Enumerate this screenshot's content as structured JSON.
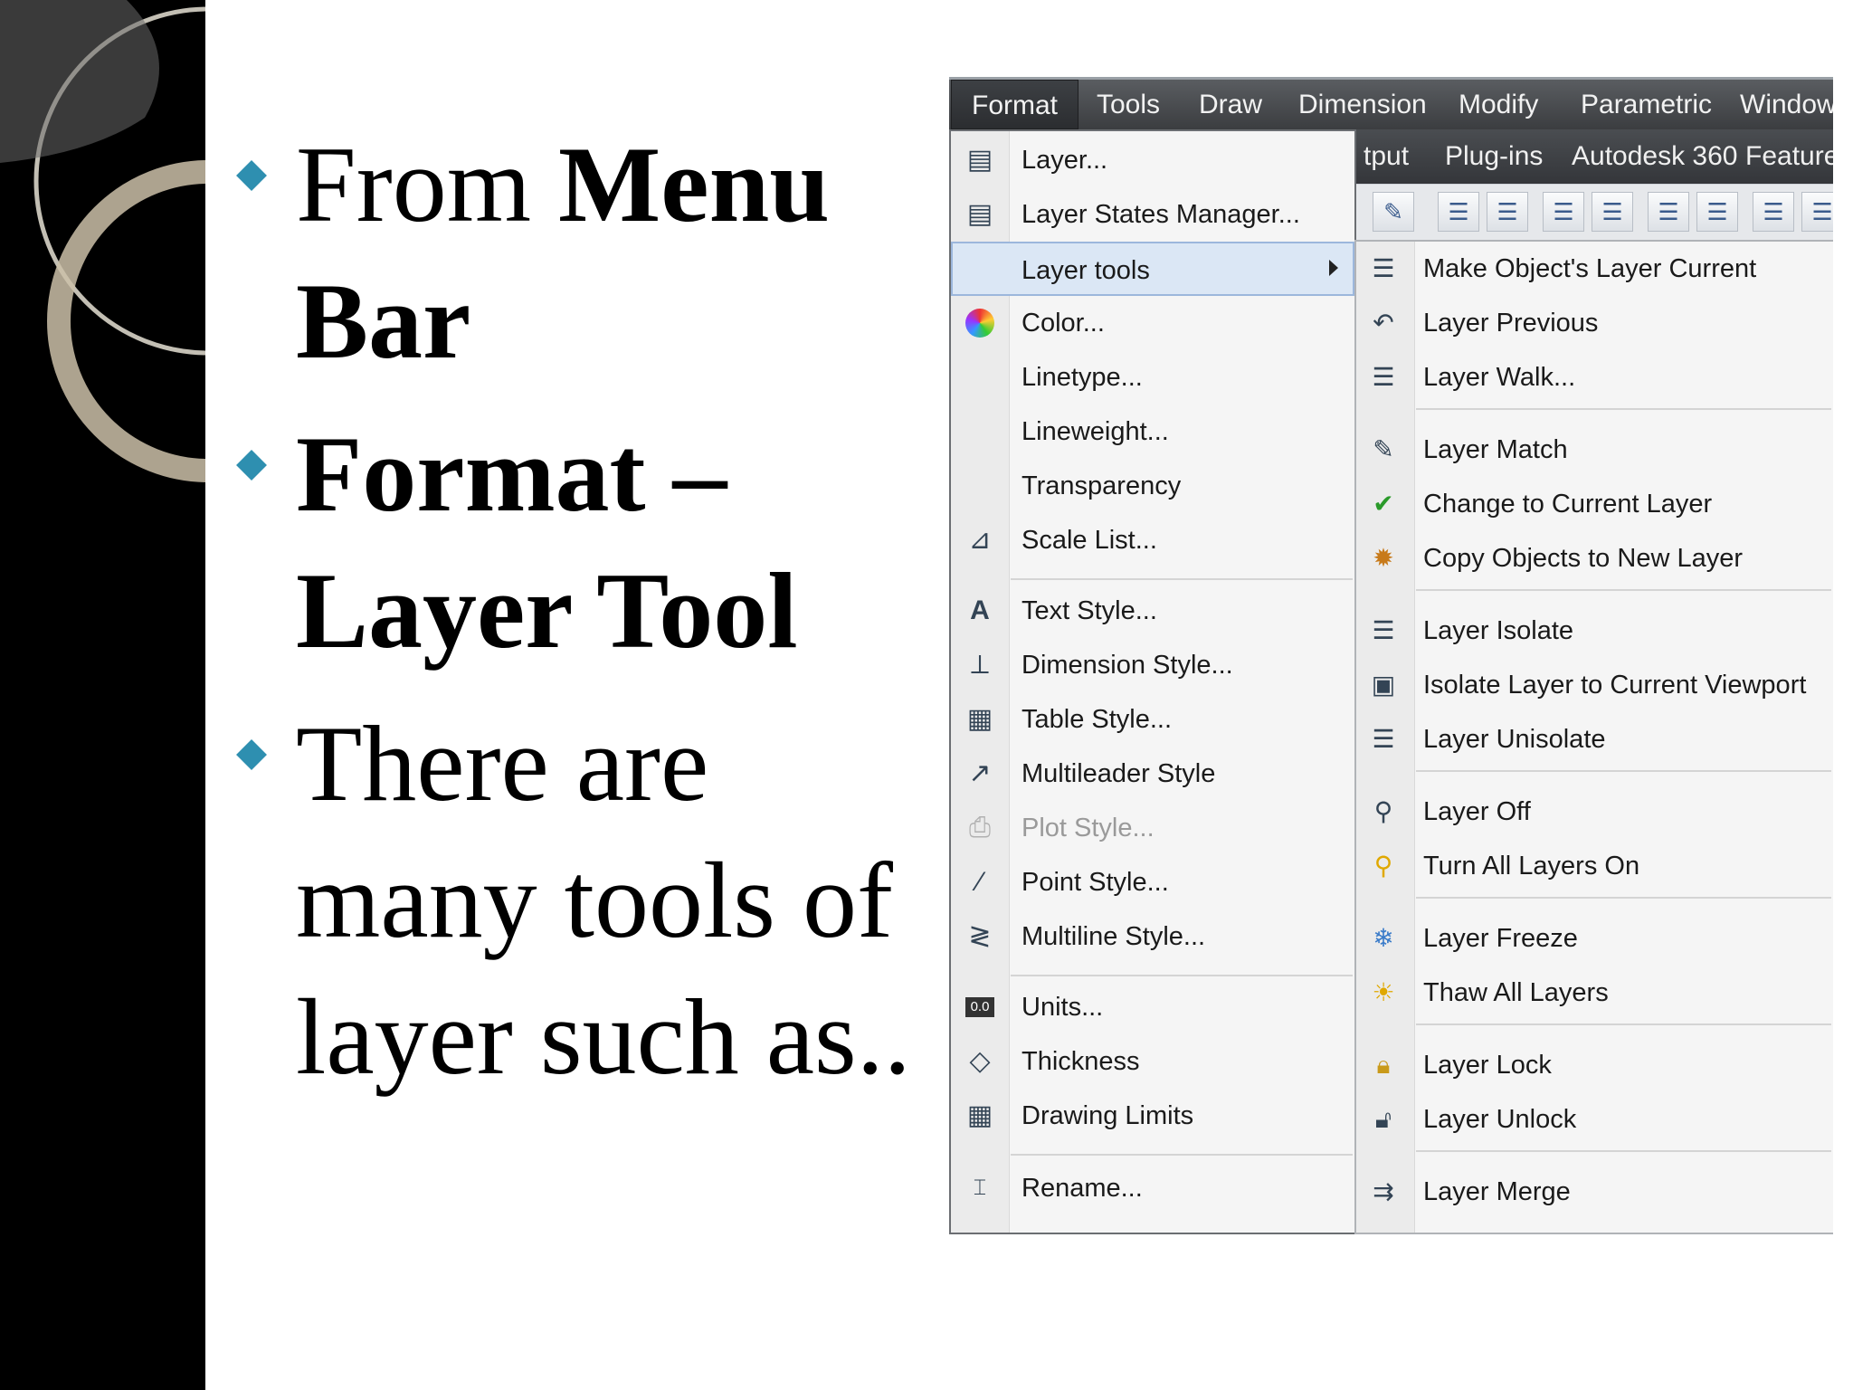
{
  "slide": {
    "bullets": [
      {
        "text": "From Menu Bar",
        "bold_parts": "partial"
      },
      {
        "text": "Format – Layer Tool"
      },
      {
        "text": "There are many tools of layer such as.."
      }
    ],
    "bullet1_a": "From ",
    "bullet1_b": "Menu Bar",
    "bullet2": "Format – Layer Tool",
    "bullet3": "There are many tools of layer such as..",
    "accent_color": "#2e8fb0"
  },
  "screenshot": {
    "menubar": [
      "Format",
      "Tools",
      "Draw",
      "Dimension",
      "Modify",
      "Parametric",
      "Window"
    ],
    "ribbon_tabs": [
      "tput",
      "Plug-ins",
      "Autodesk 360",
      "Featured"
    ],
    "format_menu": [
      {
        "label": "Layer...",
        "icon": "layer-icon"
      },
      {
        "label": "Layer States Manager...",
        "icon": "layer-states-icon"
      },
      {
        "label": "Layer tools",
        "icon": "",
        "submenu": true
      },
      {
        "label": "Color...",
        "icon": "color-wheel-icon"
      },
      {
        "label": "Linetype...",
        "icon": ""
      },
      {
        "label": "Lineweight...",
        "icon": ""
      },
      {
        "label": "Transparency",
        "icon": ""
      },
      {
        "label": "Scale List...",
        "icon": "scale-list-icon"
      },
      {
        "label": "Text Style...",
        "icon": "text-style-icon"
      },
      {
        "label": "Dimension Style...",
        "icon": "dimension-style-icon"
      },
      {
        "label": "Table Style...",
        "icon": "table-style-icon"
      },
      {
        "label": "Multileader Style",
        "icon": "multileader-style-icon"
      },
      {
        "label": "Plot Style...",
        "icon": "plot-style-icon",
        "disabled": true
      },
      {
        "label": "Point Style...",
        "icon": "point-style-icon"
      },
      {
        "label": "Multiline Style...",
        "icon": "multiline-style-icon"
      },
      {
        "label": "Units...",
        "icon": "units-icon"
      },
      {
        "label": "Thickness",
        "icon": "thickness-icon"
      },
      {
        "label": "Drawing Limits",
        "icon": "drawing-limits-icon"
      },
      {
        "label": "Rename...",
        "icon": "rename-icon"
      }
    ],
    "units_icon_text": "0.0",
    "layer_tools_submenu": [
      "Make Object's Layer Current",
      "Layer Previous",
      "Layer Walk...",
      "Layer Match",
      "Change to Current Layer",
      "Copy Objects to New Layer",
      "Layer Isolate",
      "Isolate Layer to Current Viewport",
      "Layer Unisolate",
      "Layer Off",
      "Turn All Layers On",
      "Layer Freeze",
      "Thaw All Layers",
      "Layer Lock",
      "Layer Unlock",
      "Layer Merge"
    ]
  }
}
